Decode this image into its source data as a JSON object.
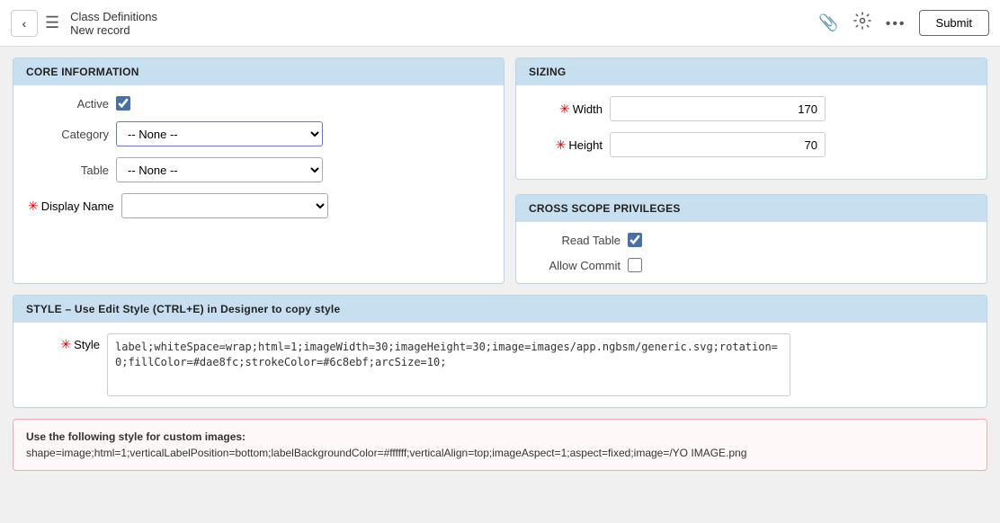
{
  "header": {
    "title": "Class Definitions",
    "subtitle": "New record",
    "back_label": "‹",
    "menu_icon": "☰",
    "attachment_icon": "📎",
    "settings_icon": "⚙",
    "more_icon": "•••",
    "submit_label": "Submit"
  },
  "core_info": {
    "section_title": "CORE INFORMATION",
    "active_label": "Active",
    "category_label": "Category",
    "category_default": "-- None --",
    "table_label": "Table",
    "table_default": "-- None --",
    "display_name_label": "Display Name",
    "display_name_value": ""
  },
  "sizing": {
    "section_title": "SIZING",
    "width_label": "Width",
    "width_value": "170",
    "height_label": "Height",
    "height_value": "70"
  },
  "cross_scope": {
    "section_title": "CROSS SCOPE PRIVILEGES",
    "read_table_label": "Read Table",
    "allow_commit_label": "Allow Commit"
  },
  "style_section": {
    "section_title": "STYLE – Use Edit Style (CTRL+E) in Designer to copy style",
    "style_label": "Style",
    "style_value": "label;whiteSpace=wrap;html=1;imageWidth=30;imageHeight=30;image=images/app.ngbsm/generic.svg;rotation=0;fillColor=#dae8fc;strokeColor=#6c8ebf;arcSize=10;"
  },
  "info_box": {
    "title": "Use the following style for custom images:",
    "text": "shape=image;html=1;verticalLabelPosition=bottom;labelBackgroundColor=#ffffff;verticalAlign=top;imageAspect=1;aspect=fixed;image=/YO",
    "text2": "IMAGE.png"
  }
}
